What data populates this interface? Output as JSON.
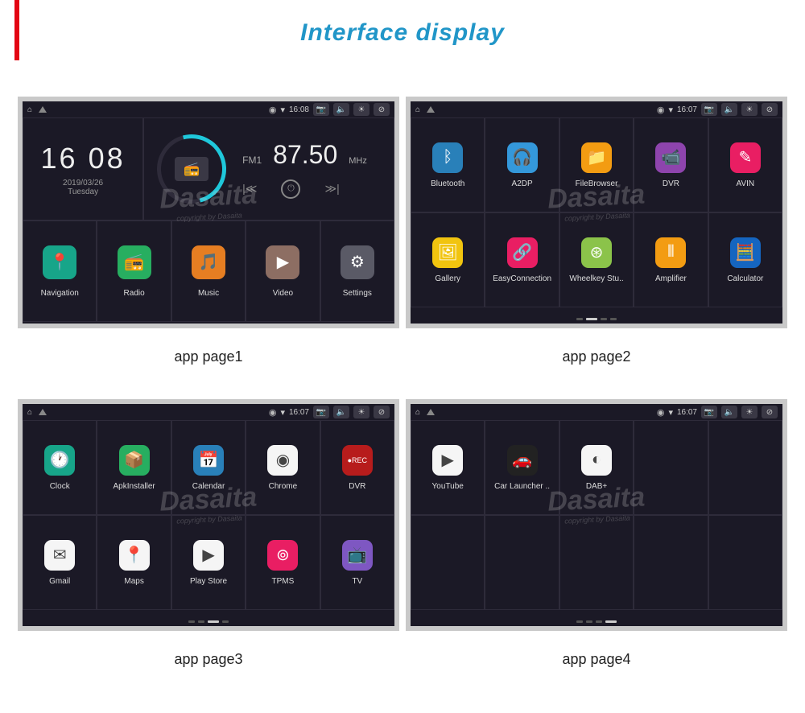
{
  "title": "Interface display",
  "captions": [
    "app page1",
    "app page2",
    "app page3",
    "app page4"
  ],
  "status": {
    "time1": "16:08",
    "time2": "16:07"
  },
  "dashboard": {
    "clock": "16 08",
    "date": "2019/03/26",
    "weekday": "Tuesday",
    "band": "FM1",
    "freq": "87.50",
    "unit": "MHz"
  },
  "page1_apps": [
    {
      "label": "Navigation",
      "color": "c-teal",
      "icon": "pin"
    },
    {
      "label": "Radio",
      "color": "c-green",
      "icon": "radio"
    },
    {
      "label": "Music",
      "color": "c-orange",
      "icon": "music"
    },
    {
      "label": "Video",
      "color": "c-brown",
      "icon": "video"
    },
    {
      "label": "Settings",
      "color": "c-grey",
      "icon": "gear"
    }
  ],
  "page2_apps_r1": [
    {
      "label": "Bluetooth",
      "color": "c-blue",
      "icon": "bt"
    },
    {
      "label": "A2DP",
      "color": "c-lblue",
      "icon": "a2dp"
    },
    {
      "label": "FileBrowser",
      "color": "c-darkorange",
      "icon": "folder"
    },
    {
      "label": "DVR",
      "color": "c-purple",
      "icon": "cam"
    },
    {
      "label": "AVIN",
      "color": "c-pink",
      "icon": "avin"
    }
  ],
  "page2_apps_r2": [
    {
      "label": "Gallery",
      "color": "c-yellow",
      "icon": "gallery"
    },
    {
      "label": "EasyConnection",
      "color": "c-pink",
      "icon": "link"
    },
    {
      "label": "Wheelkey Stu..",
      "color": "c-ygreen",
      "icon": "wheel"
    },
    {
      "label": "Amplifier",
      "color": "c-darkorange",
      "icon": "eq"
    },
    {
      "label": "Calculator",
      "color": "c-dblue",
      "icon": "calc"
    }
  ],
  "page3_apps_r1": [
    {
      "label": "Clock",
      "color": "c-teal",
      "icon": "clock"
    },
    {
      "label": "ApkInstaller",
      "color": "c-green",
      "icon": "apk"
    },
    {
      "label": "Calendar",
      "color": "c-blue",
      "icon": "cal"
    },
    {
      "label": "Chrome",
      "color": "c-white",
      "icon": "chrome"
    },
    {
      "label": "DVR",
      "color": "c-dr",
      "icon": "rec"
    }
  ],
  "page3_apps_r2": [
    {
      "label": "Gmail",
      "color": "c-white",
      "icon": "gmail"
    },
    {
      "label": "Maps",
      "color": "c-white",
      "icon": "maps"
    },
    {
      "label": "Play Store",
      "color": "c-white",
      "icon": "play"
    },
    {
      "label": "TPMS",
      "color": "c-pink",
      "icon": "tpms"
    },
    {
      "label": "TV",
      "color": "c-violet",
      "icon": "tv"
    }
  ],
  "page4_apps": [
    {
      "label": "YouTube",
      "color": "c-white",
      "icon": "yt"
    },
    {
      "label": "Car Launcher ..",
      "color": "c-black",
      "icon": "car"
    },
    {
      "label": "DAB+",
      "color": "c-white",
      "icon": "dab"
    }
  ],
  "watermark": "Dasaita",
  "watermark_sub": "copyright by Dasaita"
}
